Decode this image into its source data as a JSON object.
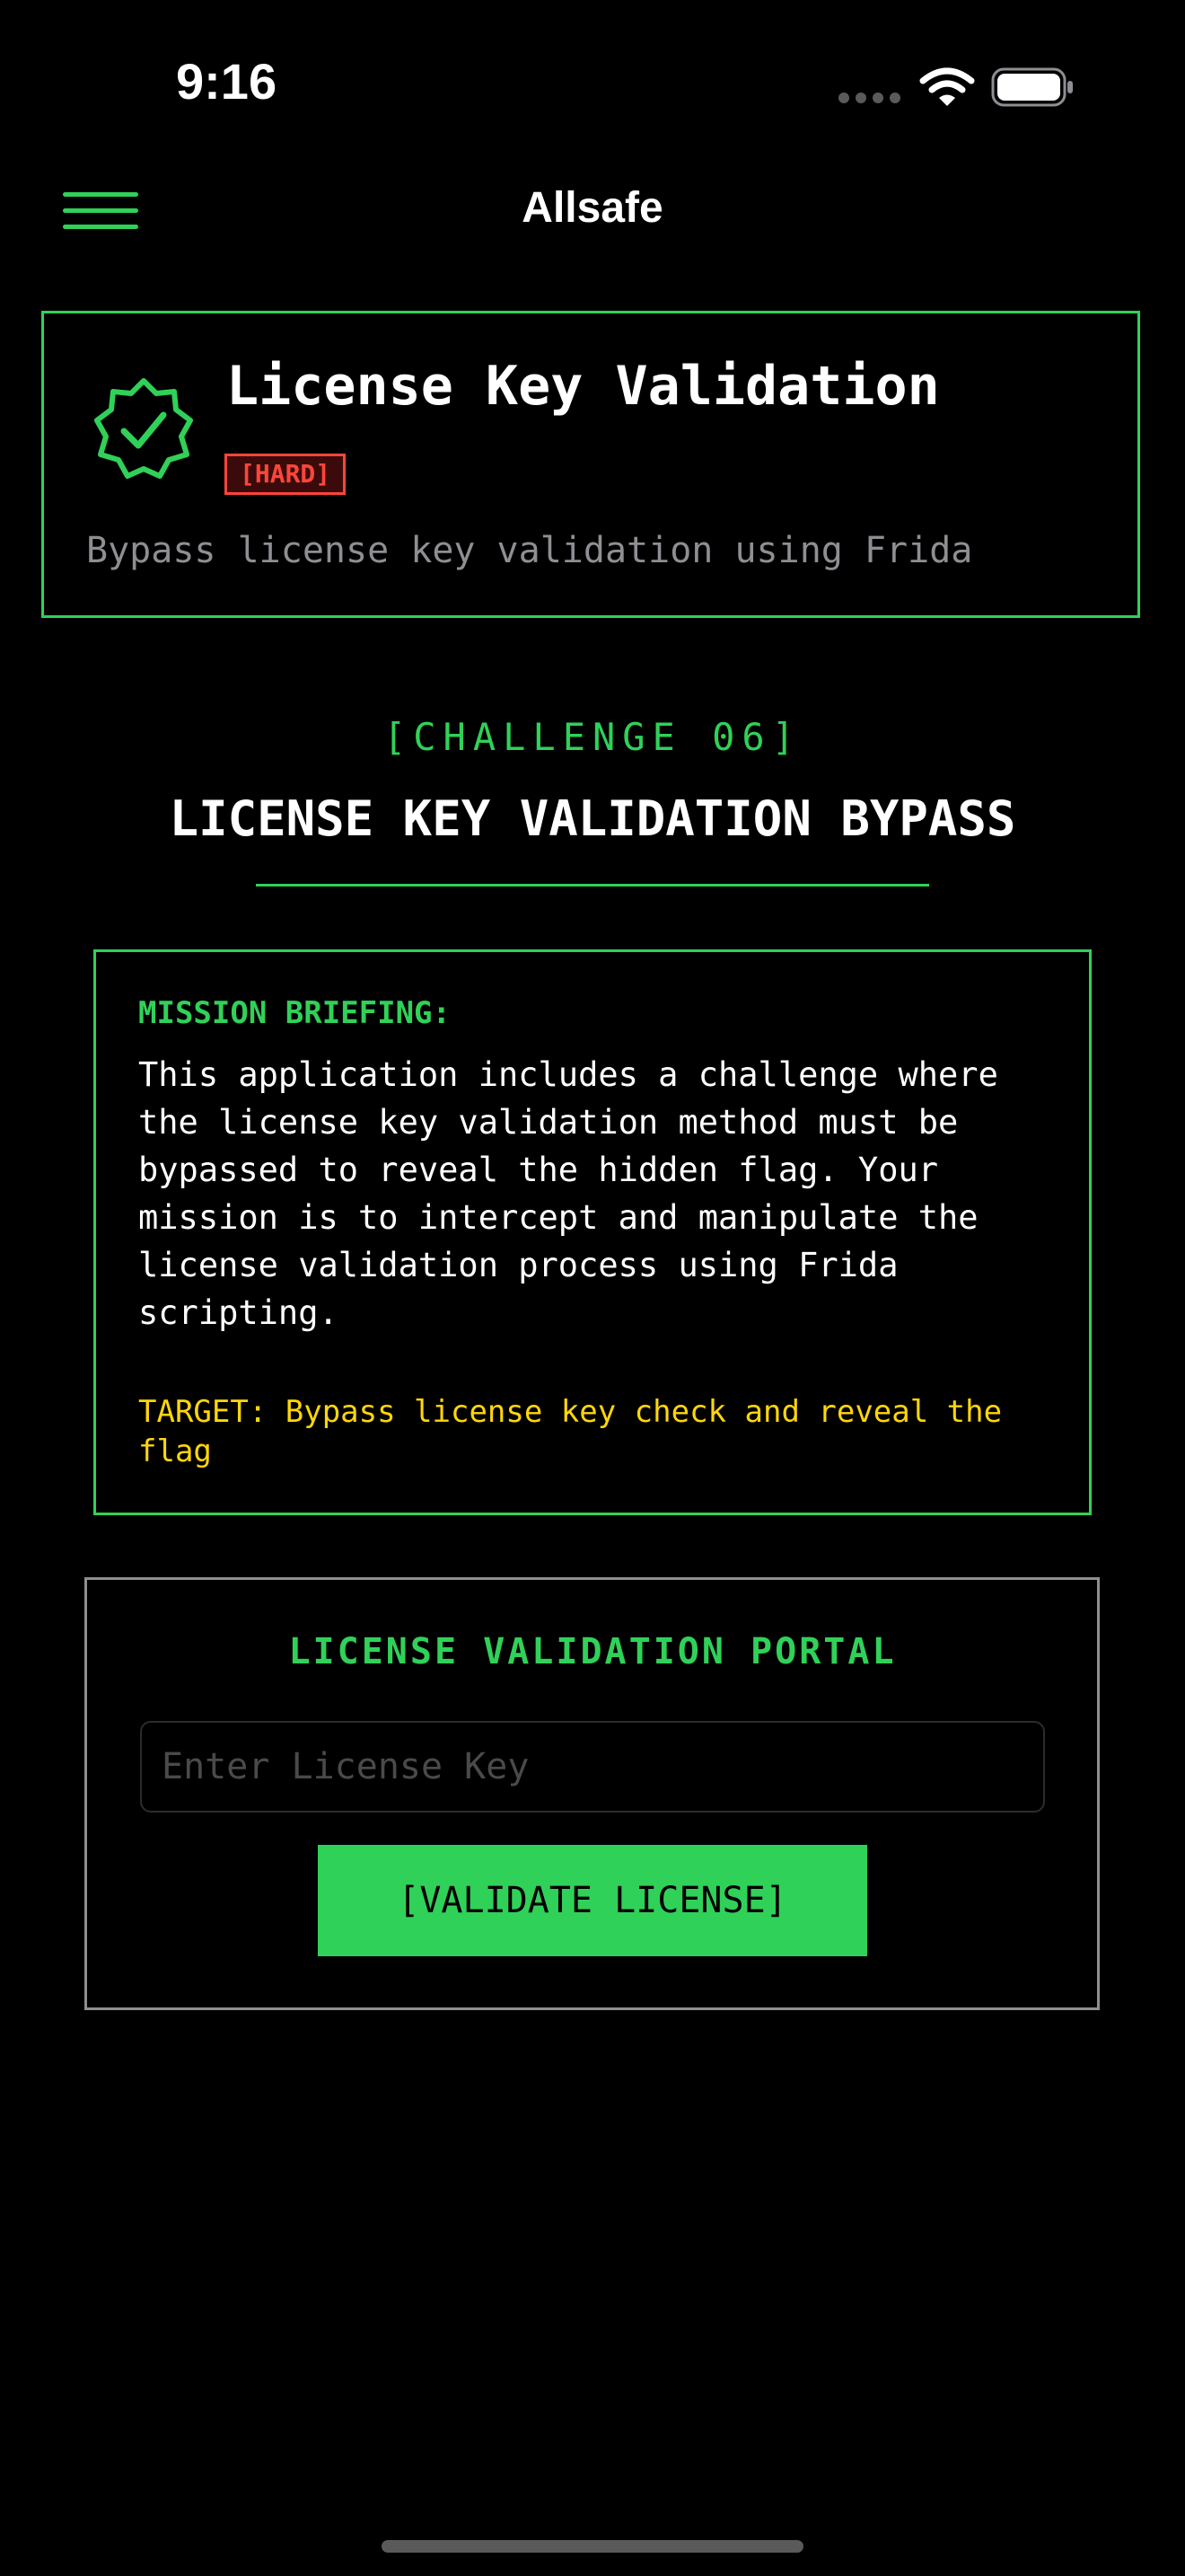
{
  "status_bar": {
    "time": "9:16",
    "icons": [
      "signal-icon",
      "wifi-icon",
      "battery-icon"
    ]
  },
  "nav": {
    "title": "Allsafe",
    "menu_icon": "hamburger-menu-icon"
  },
  "header_card": {
    "icon": "verified-badge-icon",
    "title": "License Key Validation",
    "difficulty": "[HARD]",
    "subtitle": "Bypass license key validation using Frida"
  },
  "challenge": {
    "tag": "[CHALLENGE 06]",
    "title": "LICENSE KEY VALIDATION BYPASS"
  },
  "mission": {
    "heading": "MISSION BRIEFING:",
    "body": "This application includes a challenge where the license key validation method must be bypassed to reveal the hidden flag. Your mission is to intercept and manipulate the license validation process using Frida scripting.",
    "target": "TARGET: Bypass license key check and reveal the flag"
  },
  "portal": {
    "title": "LICENSE VALIDATION PORTAL",
    "input_value": "",
    "input_placeholder": "Enter License Key",
    "button_label": "[VALIDATE LICENSE]"
  },
  "colors": {
    "accent_green": "#30d158",
    "warning_red": "#ff453a",
    "target_yellow": "#ffd60a",
    "muted_gray": "#8e8e93",
    "background": "#000000"
  }
}
